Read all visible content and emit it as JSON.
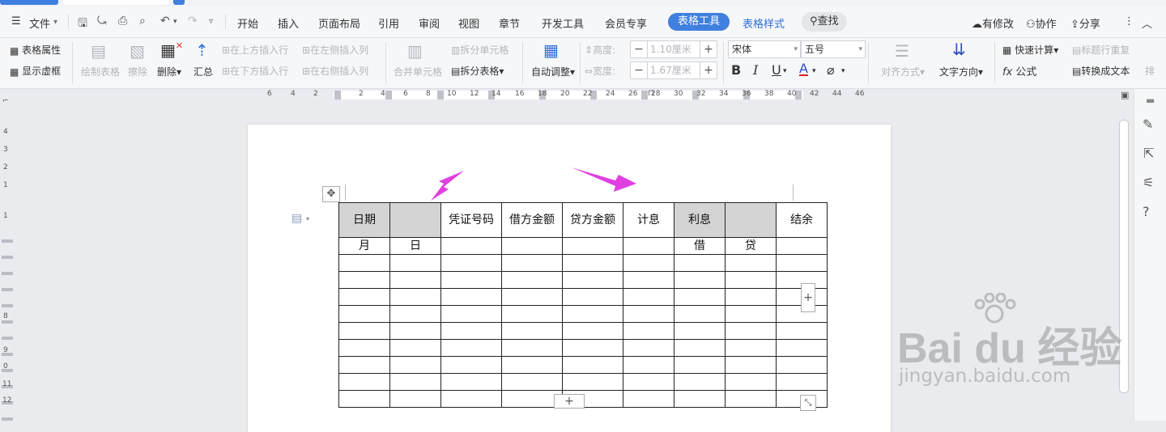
{
  "menubar": {
    "file": "文件",
    "tabs": [
      "开始",
      "插入",
      "页面布局",
      "引用",
      "审阅",
      "视图",
      "章节",
      "开发工具",
      "会员专享"
    ],
    "table_tools": "表格工具",
    "table_style": "表格样式",
    "search": "查找",
    "modified": "有修改",
    "collaborate": "协作",
    "share": "分享"
  },
  "ribbon": {
    "table_props": "表格属性",
    "show_grid": "显示虚框",
    "draw_table": "绘制表格",
    "eraser": "擦除",
    "delete": "删除",
    "summary": "汇总",
    "insert_above": "在上方插入行",
    "insert_below": "在下方插入行",
    "insert_left": "在左侧插入列",
    "insert_right": "在右侧插入列",
    "merge_cells": "合并单元格",
    "split_cells": "拆分单元格",
    "split_table": "拆分表格",
    "auto_adjust": "自动调整",
    "height_label": "高度:",
    "height_value": "1.10厘米",
    "width_label": "宽度:",
    "width_value": "1.67厘米",
    "font_name": "宋体",
    "font_size": "五号",
    "align": "对齐方式",
    "text_dir": "文字方向",
    "quick_calc": "快速计算",
    "header_repeat": "标题行重复",
    "formula": "公式",
    "to_text": "转换成文本",
    "more": "排"
  },
  "ruler": {
    "numbers": [
      "6",
      "4",
      "2",
      "2",
      "4",
      "6",
      "8",
      "10",
      "12",
      "14",
      "16",
      "18",
      "20",
      "22",
      "24",
      "26",
      "28",
      "30",
      "32",
      "34",
      "36",
      "38",
      "40",
      "42",
      "44",
      "46"
    ]
  },
  "vruler": [
    "4",
    "3",
    "2",
    "1",
    "1",
    "8",
    "9",
    "0",
    "11",
    "12"
  ],
  "table": {
    "header": [
      "日期",
      "",
      "凭证号码",
      "借方金额",
      "贷方金额",
      "计息",
      "利息",
      "",
      "结余"
    ],
    "subheader": [
      "月",
      "日",
      "",
      "",
      "",
      "",
      "借",
      "贷",
      ""
    ],
    "empty_rows": 9
  },
  "watermark": {
    "line1": "Bai du 经验",
    "line2": "jingyan.baidu.com"
  },
  "colors": {
    "accent": "#3f7fe0",
    "arrow": "#e040e0",
    "gray_cell": "#d4d4d4"
  }
}
